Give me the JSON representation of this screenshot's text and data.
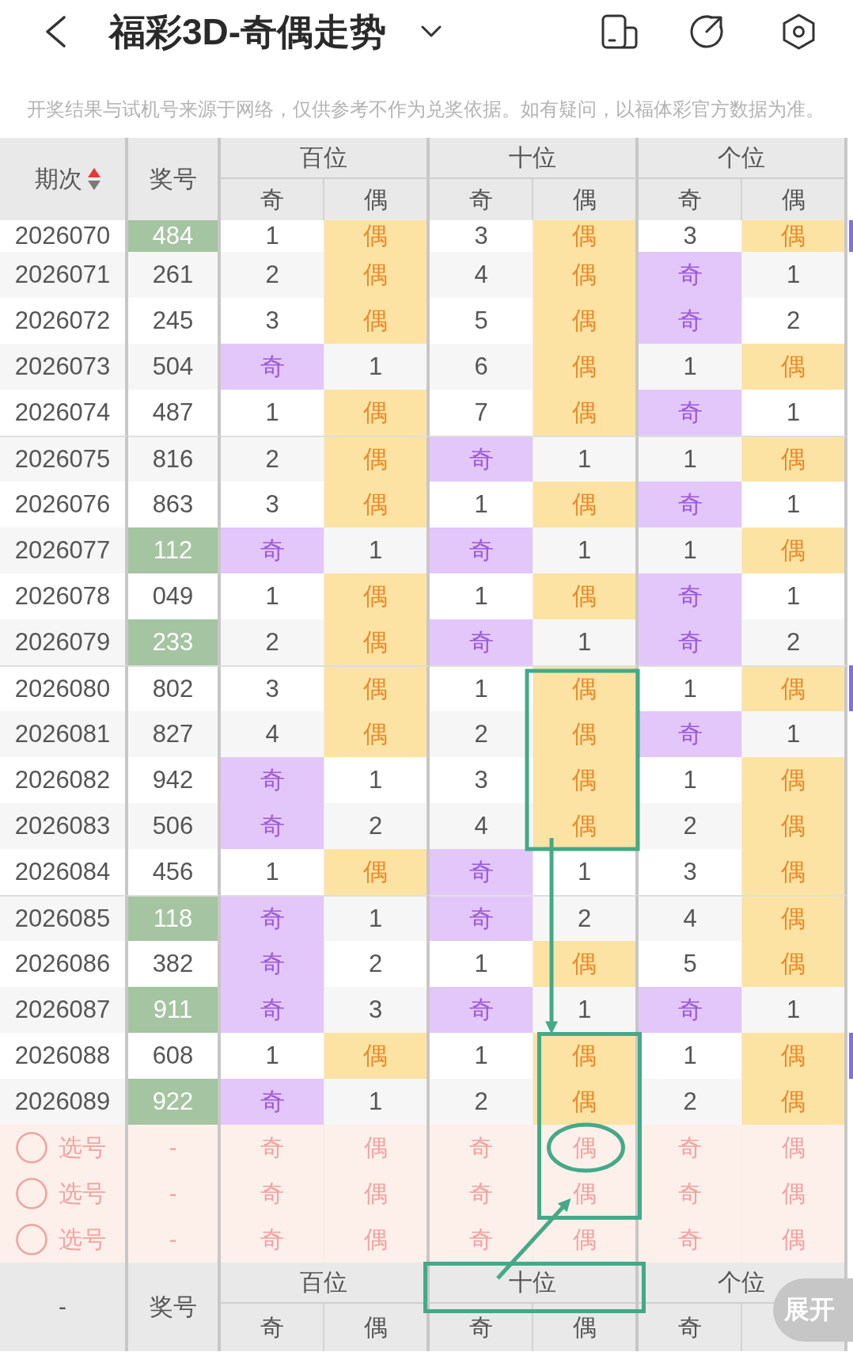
{
  "top_bar": {
    "title": "福彩3D-奇偶走势"
  },
  "notice": "开奖结果与试机号来源于网络，仅供参考不作为兑奖依据。如有疑问，以福体彩官方数据为准。",
  "table": {
    "header": {
      "issue": "期次",
      "sort_ascending": true,
      "number": "奖号",
      "groups": [
        {
          "label": "百位",
          "columns": [
            {
              "label": "奇",
              "kind": "odd"
            },
            {
              "label": "偶",
              "kind": "even"
            }
          ]
        },
        {
          "label": "十位",
          "columns": [
            {
              "label": "奇",
              "kind": "odd"
            },
            {
              "label": "偶",
              "kind": "even"
            }
          ]
        },
        {
          "label": "个位",
          "columns": [
            {
              "label": "奇",
              "kind": "odd"
            },
            {
              "label": "偶",
              "kind": "even"
            }
          ]
        }
      ]
    },
    "rows": [
      {
        "issue": "2026070",
        "number": "484",
        "pair": true,
        "edge_marker": true,
        "cells": [
          {
            "text": "1",
            "hit": false
          },
          {
            "text": "偶",
            "hit": true
          },
          {
            "text": "3",
            "hit": false
          },
          {
            "text": "偶",
            "hit": true
          },
          {
            "text": "3",
            "hit": false
          },
          {
            "text": "偶",
            "hit": true
          }
        ]
      },
      {
        "issue": "2026071",
        "number": "261",
        "pair": false,
        "edge_marker": false,
        "cells": [
          {
            "text": "2",
            "hit": false
          },
          {
            "text": "偶",
            "hit": true
          },
          {
            "text": "4",
            "hit": false
          },
          {
            "text": "偶",
            "hit": true
          },
          {
            "text": "奇",
            "hit": true
          },
          {
            "text": "1",
            "hit": false
          }
        ]
      },
      {
        "issue": "2026072",
        "number": "245",
        "pair": false,
        "edge_marker": false,
        "cells": [
          {
            "text": "3",
            "hit": false
          },
          {
            "text": "偶",
            "hit": true
          },
          {
            "text": "5",
            "hit": false
          },
          {
            "text": "偶",
            "hit": true
          },
          {
            "text": "奇",
            "hit": true
          },
          {
            "text": "2",
            "hit": false
          }
        ]
      },
      {
        "issue": "2026073",
        "number": "504",
        "pair": false,
        "edge_marker": false,
        "cells": [
          {
            "text": "奇",
            "hit": true
          },
          {
            "text": "1",
            "hit": false
          },
          {
            "text": "6",
            "hit": false
          },
          {
            "text": "偶",
            "hit": true
          },
          {
            "text": "1",
            "hit": false
          },
          {
            "text": "偶",
            "hit": true
          }
        ]
      },
      {
        "issue": "2026074",
        "number": "487",
        "pair": false,
        "edge_marker": false,
        "cells": [
          {
            "text": "1",
            "hit": false
          },
          {
            "text": "偶",
            "hit": true
          },
          {
            "text": "7",
            "hit": false
          },
          {
            "text": "偶",
            "hit": true
          },
          {
            "text": "奇",
            "hit": true
          },
          {
            "text": "1",
            "hit": false
          }
        ]
      },
      {
        "issue": "2026075",
        "number": "816",
        "pair": false,
        "edge_marker": false,
        "cells": [
          {
            "text": "2",
            "hit": false
          },
          {
            "text": "偶",
            "hit": true
          },
          {
            "text": "奇",
            "hit": true
          },
          {
            "text": "1",
            "hit": false
          },
          {
            "text": "1",
            "hit": false
          },
          {
            "text": "偶",
            "hit": true
          }
        ]
      },
      {
        "issue": "2026076",
        "number": "863",
        "pair": false,
        "edge_marker": false,
        "cells": [
          {
            "text": "3",
            "hit": false
          },
          {
            "text": "偶",
            "hit": true
          },
          {
            "text": "1",
            "hit": false
          },
          {
            "text": "偶",
            "hit": true
          },
          {
            "text": "奇",
            "hit": true
          },
          {
            "text": "1",
            "hit": false
          }
        ]
      },
      {
        "issue": "2026077",
        "number": "112",
        "pair": true,
        "edge_marker": false,
        "cells": [
          {
            "text": "奇",
            "hit": true
          },
          {
            "text": "1",
            "hit": false
          },
          {
            "text": "奇",
            "hit": true
          },
          {
            "text": "1",
            "hit": false
          },
          {
            "text": "1",
            "hit": false
          },
          {
            "text": "偶",
            "hit": true
          }
        ]
      },
      {
        "issue": "2026078",
        "number": "049",
        "pair": false,
        "edge_marker": false,
        "cells": [
          {
            "text": "1",
            "hit": false
          },
          {
            "text": "偶",
            "hit": true
          },
          {
            "text": "1",
            "hit": false
          },
          {
            "text": "偶",
            "hit": true
          },
          {
            "text": "奇",
            "hit": true
          },
          {
            "text": "1",
            "hit": false
          }
        ]
      },
      {
        "issue": "2026079",
        "number": "233",
        "pair": true,
        "edge_marker": false,
        "cells": [
          {
            "text": "2",
            "hit": false
          },
          {
            "text": "偶",
            "hit": true
          },
          {
            "text": "奇",
            "hit": true
          },
          {
            "text": "1",
            "hit": false
          },
          {
            "text": "奇",
            "hit": true
          },
          {
            "text": "2",
            "hit": false
          }
        ]
      },
      {
        "issue": "2026080",
        "number": "802",
        "pair": false,
        "edge_marker": true,
        "cells": [
          {
            "text": "3",
            "hit": false
          },
          {
            "text": "偶",
            "hit": true
          },
          {
            "text": "1",
            "hit": false
          },
          {
            "text": "偶",
            "hit": true
          },
          {
            "text": "1",
            "hit": false
          },
          {
            "text": "偶",
            "hit": true
          }
        ]
      },
      {
        "issue": "2026081",
        "number": "827",
        "pair": false,
        "edge_marker": false,
        "cells": [
          {
            "text": "4",
            "hit": false
          },
          {
            "text": "偶",
            "hit": true
          },
          {
            "text": "2",
            "hit": false
          },
          {
            "text": "偶",
            "hit": true
          },
          {
            "text": "奇",
            "hit": true
          },
          {
            "text": "1",
            "hit": false
          }
        ]
      },
      {
        "issue": "2026082",
        "number": "942",
        "pair": false,
        "edge_marker": false,
        "cells": [
          {
            "text": "奇",
            "hit": true
          },
          {
            "text": "1",
            "hit": false
          },
          {
            "text": "3",
            "hit": false
          },
          {
            "text": "偶",
            "hit": true
          },
          {
            "text": "1",
            "hit": false
          },
          {
            "text": "偶",
            "hit": true
          }
        ]
      },
      {
        "issue": "2026083",
        "number": "506",
        "pair": false,
        "edge_marker": false,
        "cells": [
          {
            "text": "奇",
            "hit": true
          },
          {
            "text": "2",
            "hit": false
          },
          {
            "text": "4",
            "hit": false
          },
          {
            "text": "偶",
            "hit": true
          },
          {
            "text": "2",
            "hit": false
          },
          {
            "text": "偶",
            "hit": true
          }
        ]
      },
      {
        "issue": "2026084",
        "number": "456",
        "pair": false,
        "edge_marker": false,
        "cells": [
          {
            "text": "1",
            "hit": false
          },
          {
            "text": "偶",
            "hit": true
          },
          {
            "text": "奇",
            "hit": true
          },
          {
            "text": "1",
            "hit": false
          },
          {
            "text": "3",
            "hit": false
          },
          {
            "text": "偶",
            "hit": true
          }
        ]
      },
      {
        "issue": "2026085",
        "number": "118",
        "pair": true,
        "edge_marker": false,
        "cells": [
          {
            "text": "奇",
            "hit": true
          },
          {
            "text": "1",
            "hit": false
          },
          {
            "text": "奇",
            "hit": true
          },
          {
            "text": "2",
            "hit": false
          },
          {
            "text": "4",
            "hit": false
          },
          {
            "text": "偶",
            "hit": true
          }
        ]
      },
      {
        "issue": "2026086",
        "number": "382",
        "pair": false,
        "edge_marker": false,
        "cells": [
          {
            "text": "奇",
            "hit": true
          },
          {
            "text": "2",
            "hit": false
          },
          {
            "text": "1",
            "hit": false
          },
          {
            "text": "偶",
            "hit": true
          },
          {
            "text": "5",
            "hit": false
          },
          {
            "text": "偶",
            "hit": true
          }
        ]
      },
      {
        "issue": "2026087",
        "number": "911",
        "pair": true,
        "edge_marker": false,
        "cells": [
          {
            "text": "奇",
            "hit": true
          },
          {
            "text": "3",
            "hit": false
          },
          {
            "text": "奇",
            "hit": true
          },
          {
            "text": "1",
            "hit": false
          },
          {
            "text": "奇",
            "hit": true
          },
          {
            "text": "1",
            "hit": false
          }
        ]
      },
      {
        "issue": "2026088",
        "number": "608",
        "pair": false,
        "edge_marker": true,
        "cells": [
          {
            "text": "1",
            "hit": false
          },
          {
            "text": "偶",
            "hit": true
          },
          {
            "text": "1",
            "hit": false
          },
          {
            "text": "偶",
            "hit": true
          },
          {
            "text": "1",
            "hit": false
          },
          {
            "text": "偶",
            "hit": true
          }
        ]
      },
      {
        "issue": "2026089",
        "number": "922",
        "pair": true,
        "edge_marker": false,
        "cells": [
          {
            "text": "奇",
            "hit": true
          },
          {
            "text": "1",
            "hit": false
          },
          {
            "text": "2",
            "hit": false
          },
          {
            "text": "偶",
            "hit": true
          },
          {
            "text": "2",
            "hit": false
          },
          {
            "text": "偶",
            "hit": true
          }
        ]
      }
    ],
    "pick_rows": [
      {
        "label": "选号",
        "selected": false,
        "number": "-",
        "cells": [
          "奇",
          "偶",
          "奇",
          "偶",
          "奇",
          "偶"
        ]
      },
      {
        "label": "选号",
        "selected": false,
        "number": "-",
        "cells": [
          "奇",
          "偶",
          "奇",
          "偶",
          "奇",
          "偶"
        ]
      },
      {
        "label": "选号",
        "selected": false,
        "number": "-",
        "cells": [
          "奇",
          "偶",
          "奇",
          "偶",
          "奇",
          "偶"
        ]
      }
    ],
    "footer": {
      "issue": "-",
      "number": "奖号",
      "groups": [
        {
          "label": "百位",
          "columns": [
            "奇",
            "偶"
          ]
        },
        {
          "label": "十位",
          "columns": [
            "奇",
            "偶"
          ]
        },
        {
          "label": "个位",
          "columns": [
            "奇"
          ]
        }
      ]
    }
  },
  "expand_button": "展开"
}
